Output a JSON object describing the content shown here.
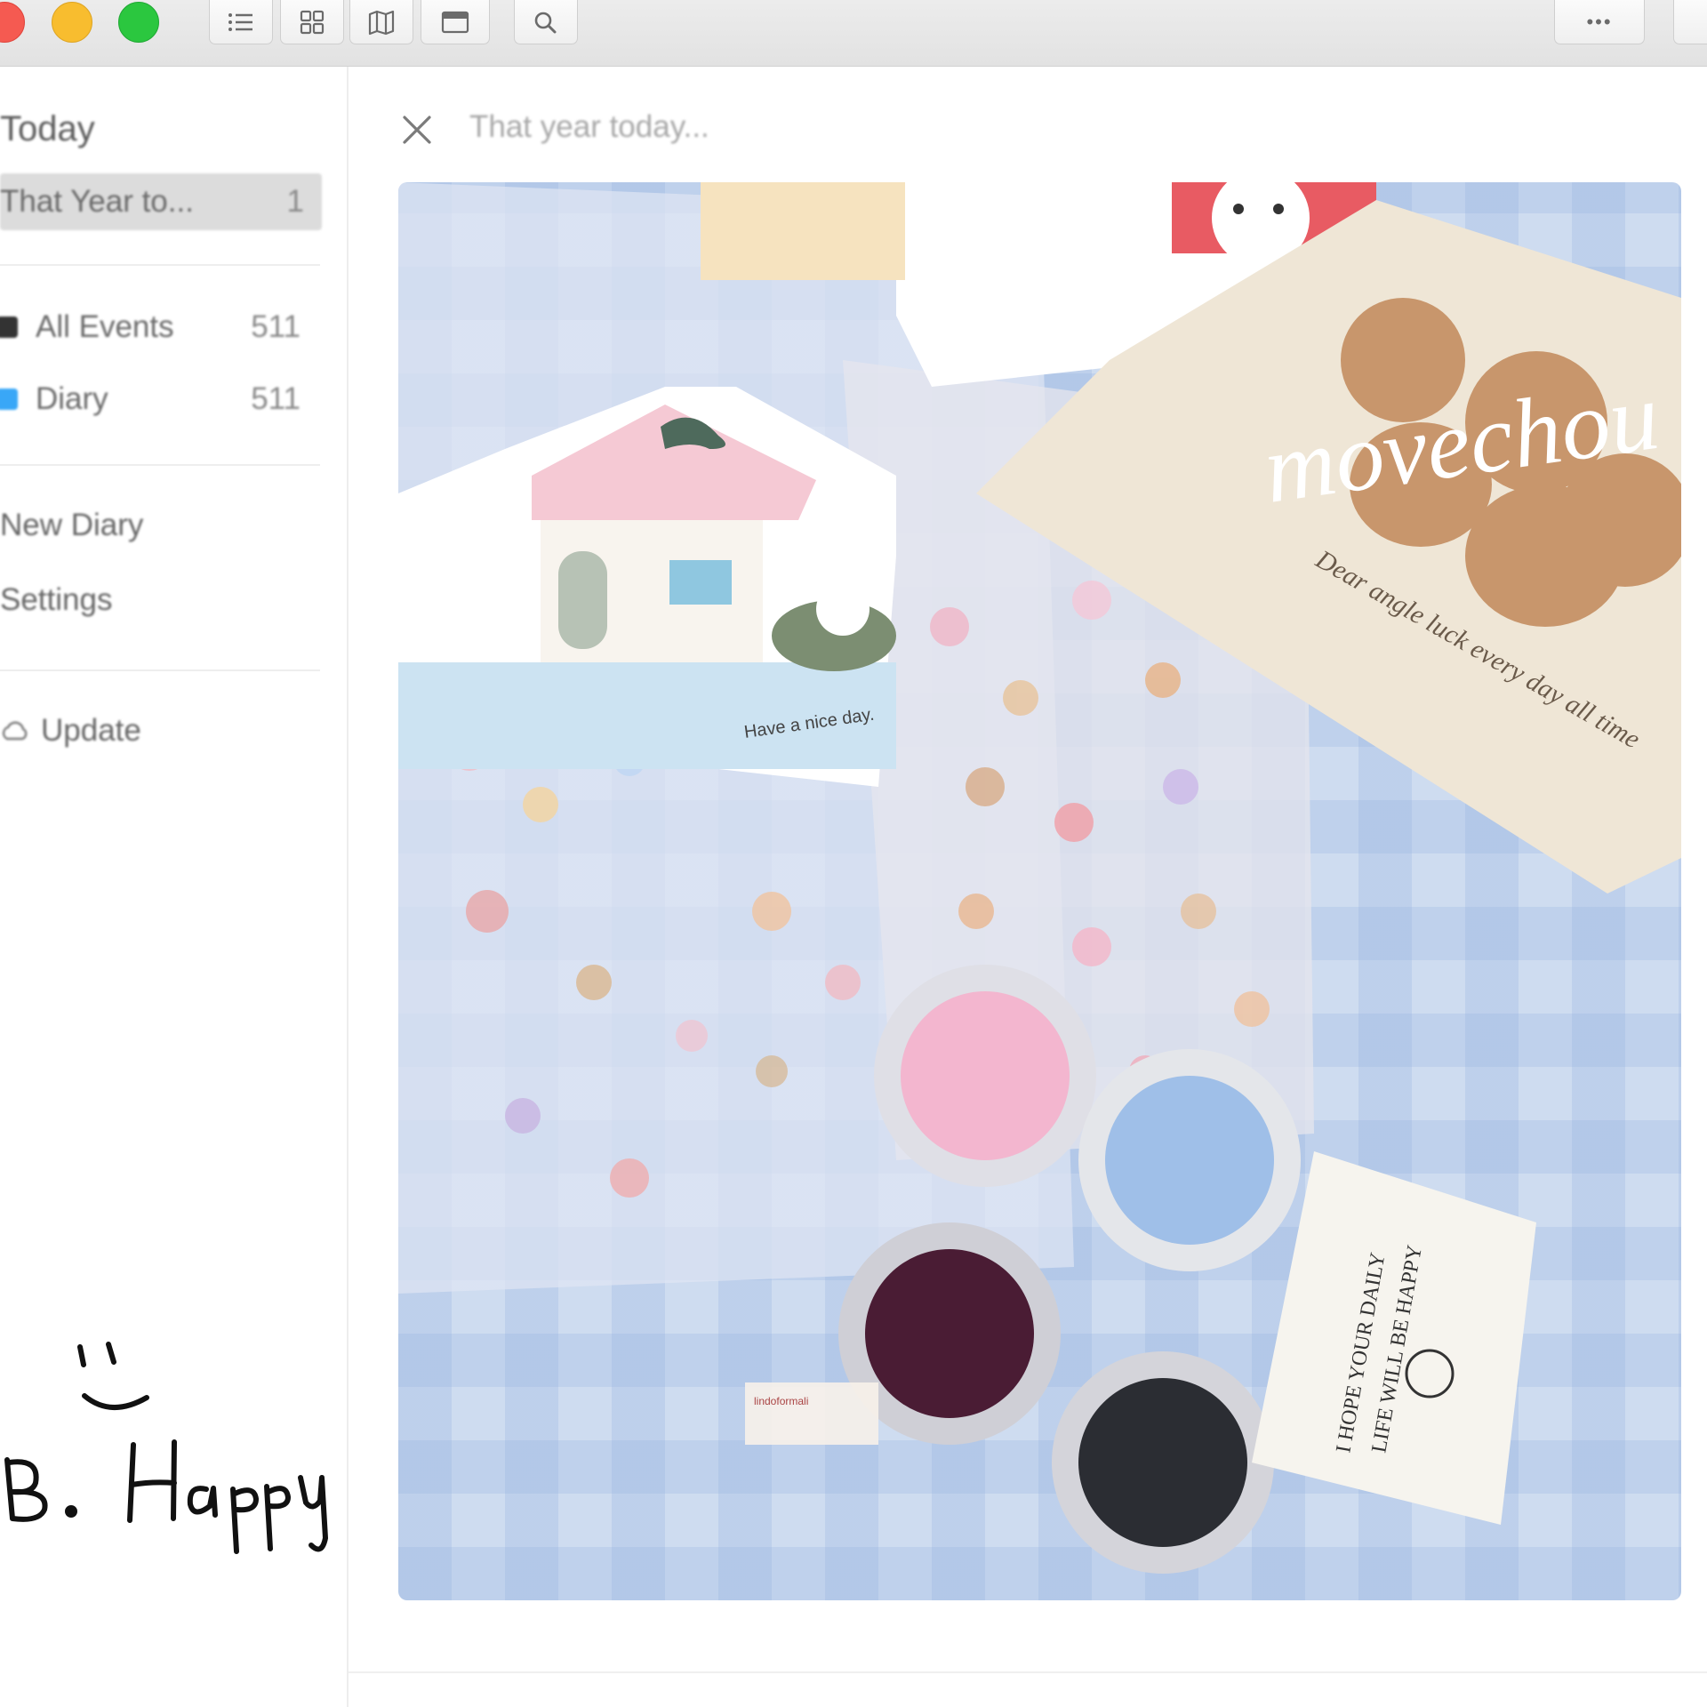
{
  "window": {
    "toolbar": {
      "buttons": [
        "list-view",
        "grid-view",
        "map-view",
        "calendar-view",
        "search"
      ],
      "more_label": "•••"
    }
  },
  "sidebar": {
    "heading": "Today",
    "selected_item": {
      "label": "That Year to...",
      "count": "1"
    },
    "journals": [
      {
        "label": "All Events",
        "count": "511",
        "color": "#333333"
      },
      {
        "label": "Diary",
        "count": "511",
        "color": "#39a7f7"
      }
    ],
    "links": {
      "new_diary": "New Diary",
      "settings": "Settings",
      "update": "Update"
    }
  },
  "main": {
    "search_text": "That year today...",
    "photo": {
      "card_text": "Have a nice day.",
      "brand": "movechou",
      "brand_tagline": "Dear angle luck every day all time",
      "tag_text_1": "I HOPE YOUR DAILY",
      "tag_text_2": "LIFE WILL BE HAPPY",
      "sticker_label": "lindoformali"
    }
  },
  "handwriting_note": "Be Happy"
}
